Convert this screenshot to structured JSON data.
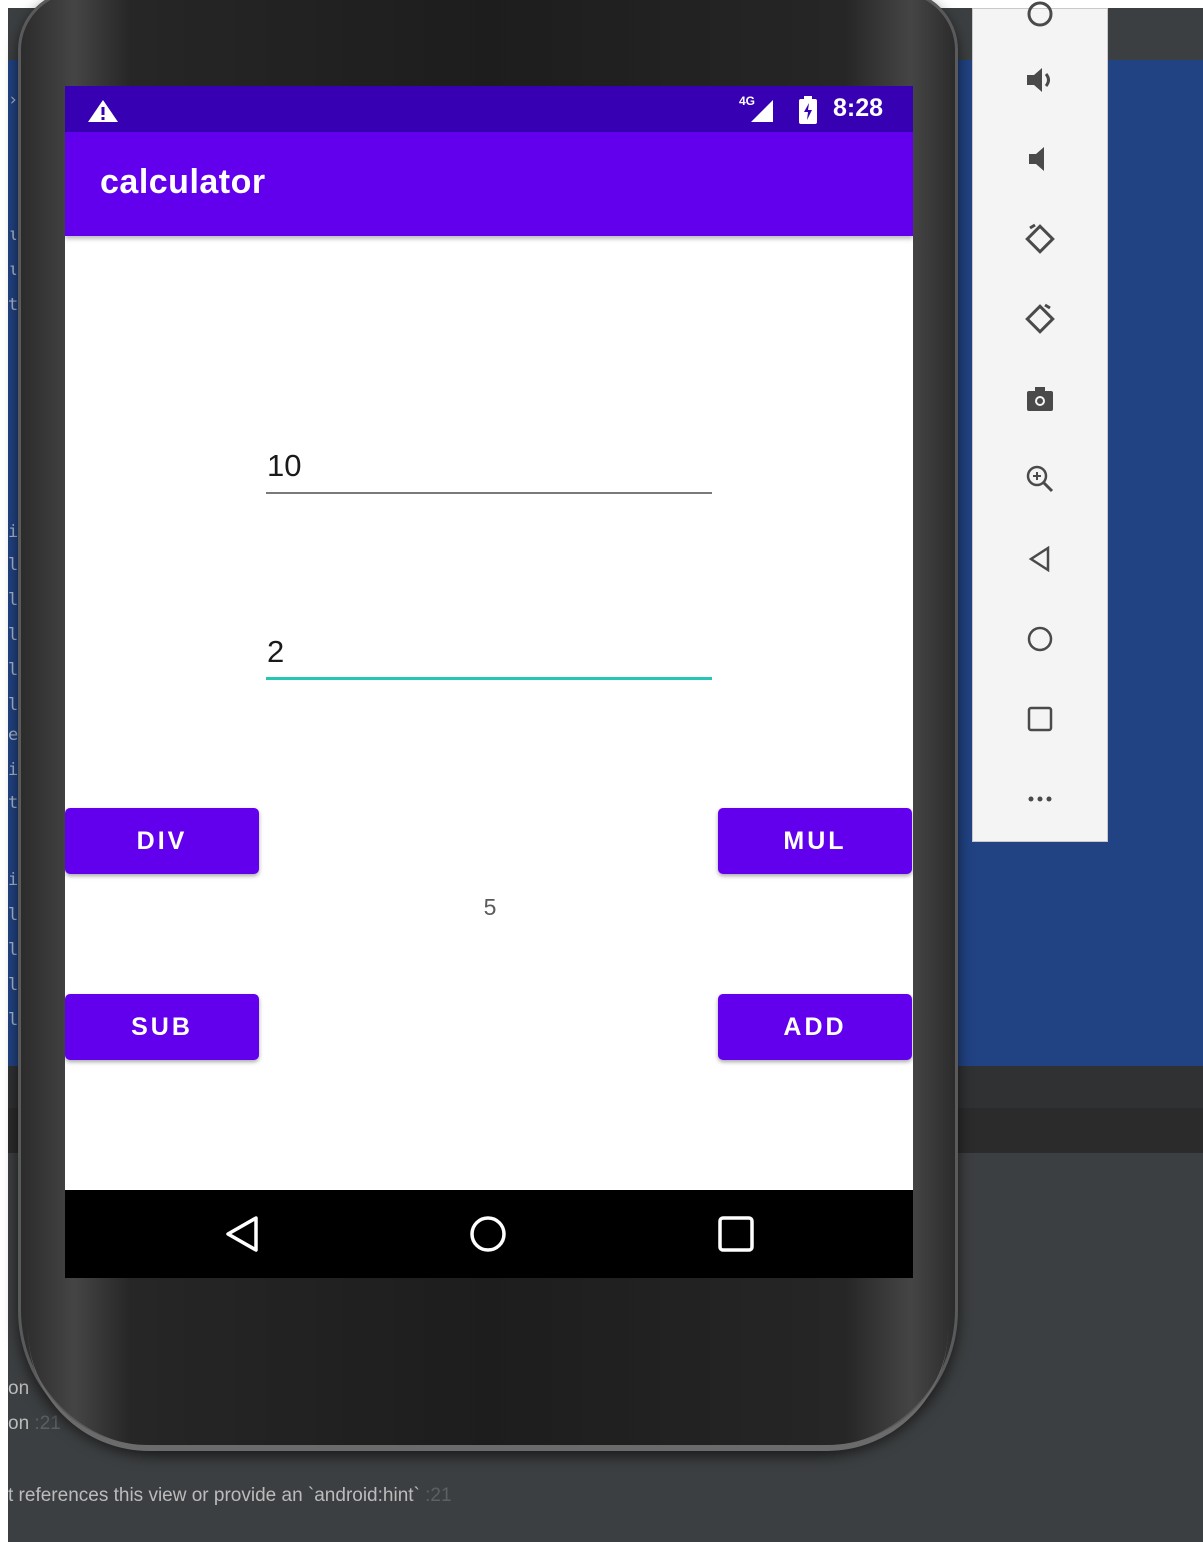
{
  "app": {
    "title": "calculator"
  },
  "status_bar": {
    "network": "4G",
    "time": "8:28"
  },
  "fields": {
    "first_value": "10",
    "second_value": "2"
  },
  "buttons": {
    "div": "DIV",
    "mul": "MUL",
    "sub": "SUB",
    "add": "ADD"
  },
  "result": "5",
  "emulator_toolbar": {
    "items": [
      "volume-up-icon",
      "volume-down-icon",
      "rotate-left-icon",
      "rotate-right-icon",
      "camera-icon",
      "zoom-icon",
      "back-icon",
      "home-icon",
      "overview-icon",
      "more-icon"
    ]
  },
  "ide": {
    "console_lines": [
      {
        "text": "on",
        "suffix": ""
      },
      {
        "text": "on",
        "suffix": ":21"
      },
      {
        "text": "t references this view or provide an `android:hint`",
        "suffix": ":21"
      }
    ]
  },
  "colors": {
    "primary": "#6200ee",
    "primary_dark": "#3700b3",
    "accent": "#26c6b5"
  }
}
